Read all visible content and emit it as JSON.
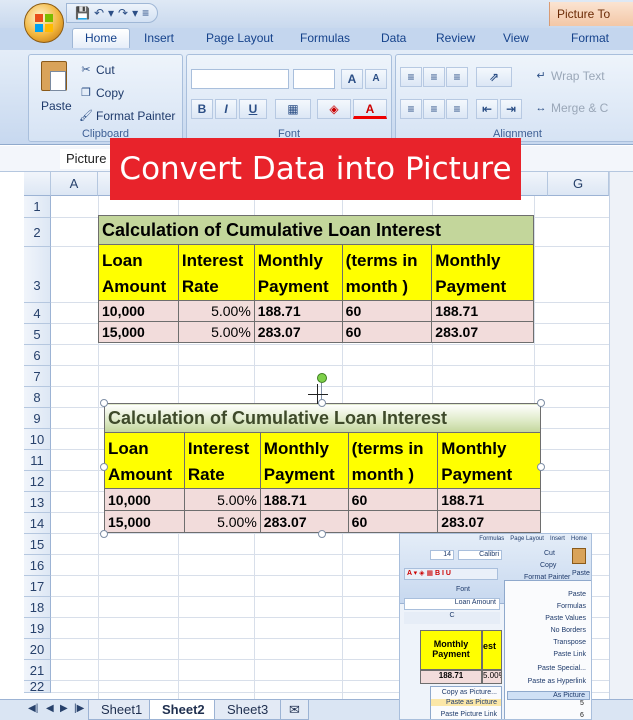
{
  "title_bar": {
    "picture_tools": "Picture To"
  },
  "tabs": [
    "Home",
    "Insert",
    "Page Layout",
    "Formulas",
    "Data",
    "Review",
    "View",
    "Format"
  ],
  "ribbon": {
    "clipboard": {
      "paste": "Paste",
      "cut": "Cut",
      "copy": "Copy",
      "format_painter": "Format Painter",
      "label": "Clipboard"
    },
    "font": {
      "label": "Font",
      "bold": "B",
      "italic": "I",
      "underline": "U",
      "grow": "A",
      "shrink": "A",
      "font_color": "A"
    },
    "alignment": {
      "label": "Alignment",
      "wrap_text": "Wrap Text",
      "merge": "Merge & C"
    }
  },
  "name_box": "Picture",
  "banner": "Convert Data into Picture",
  "columns": [
    "A",
    "G"
  ],
  "rows": [
    "1",
    "2",
    "3",
    "4",
    "5",
    "6",
    "7",
    "8",
    "9",
    "10",
    "11",
    "12",
    "13",
    "14",
    "15",
    "16",
    "17",
    "18",
    "19",
    "20",
    "21",
    "22"
  ],
  "table": {
    "title": "Calculation of Cumulative Loan Interest",
    "headers": [
      [
        "Loan",
        "Amount"
      ],
      [
        "Interest",
        "Rate"
      ],
      [
        "Monthly",
        "Payment"
      ],
      [
        "(terms in",
        "month )"
      ],
      [
        "Monthly",
        "Payment"
      ]
    ],
    "rows": [
      [
        "10,000",
        "5.00%",
        "188.71",
        "60",
        "188.71"
      ],
      [
        "15,000",
        "5.00%",
        "283.07",
        "60",
        "283.07"
      ]
    ]
  },
  "sheet_tabs": [
    "Sheet1",
    "Sheet2",
    "Sheet3"
  ],
  "active_sheet": "Sheet2",
  "inset": {
    "tabs": [
      "Home",
      "Insert",
      "Page Layout",
      "Formulas"
    ],
    "font_name": "Calibri",
    "font_size": "14",
    "cut": "Cut",
    "copy": "Copy",
    "format_painter": "Format Painter",
    "paste": "Paste",
    "font_label": "Font",
    "name_box": "Loan Amount",
    "col": "C",
    "menu": [
      "Paste",
      "Formulas",
      "Paste Values",
      "No Borders",
      "Transpose",
      "Paste Link",
      "Paste Special...",
      "Paste as Hyperlink",
      "As Picture"
    ],
    "submenu": [
      "Copy as Picture...",
      "Paste as Picture",
      "Paste Picture Link"
    ],
    "cell_hdr": [
      "Monthly",
      "Payment"
    ],
    "cell_partial": "est",
    "cell_val": "188.71",
    "cell_pct": "5.00%",
    "row_nums": [
      "5",
      "6"
    ]
  },
  "colors": {
    "banner": "#e8232b",
    "title_fill": "#c3d69b",
    "header_fill": "#ffff00",
    "data_fill": "#f2dcdb"
  }
}
